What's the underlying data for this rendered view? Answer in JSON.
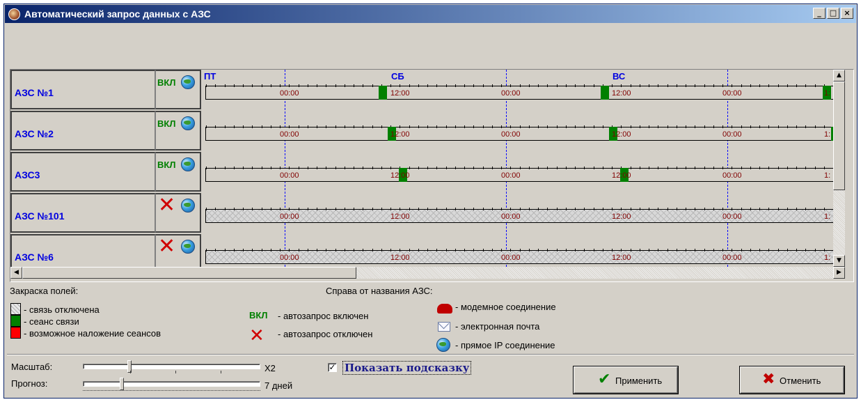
{
  "window": {
    "title": "Автоматический запрос данных с АЗС",
    "buttons": [
      "_",
      "□",
      "×"
    ]
  },
  "timeline": {
    "days": [
      "ПТ",
      "СБ",
      "ВС"
    ],
    "time_labels": [
      "00:00",
      "12:00",
      "00:00",
      "12:00",
      "00:00",
      "1:"
    ]
  },
  "stations": [
    {
      "name": "АЗС №1",
      "status": "ВКЛ",
      "enabled": true,
      "connection": "globe-icon"
    },
    {
      "name": "АЗС №2",
      "status": "ВКЛ",
      "enabled": true,
      "connection": "globe-icon"
    },
    {
      "name": "АЗС3",
      "status": "ВКЛ",
      "enabled": true,
      "connection": "globe-icon"
    },
    {
      "name": "АЗС №101",
      "status": "",
      "enabled": false,
      "connection": "globe-icon"
    },
    {
      "name": "АЗС №6",
      "status": "",
      "enabled": false,
      "connection": "globe-icon"
    }
  ],
  "legend": {
    "fill_title": "Закраска полей:",
    "fill_items": [
      {
        "label": "- связь отключена",
        "color": "#d8d8d8"
      },
      {
        "label": "- сеанс связи",
        "color": "#008000"
      },
      {
        "label": "- возможное наложение сеансов",
        "color": "#ff0000"
      }
    ],
    "right_title": "Справа от названия АЗС:",
    "vkl_symbol": "ВКЛ",
    "vkl_label": "- автозапрос включен",
    "off_label": "- автозапрос отключен",
    "modem_label": "- модемное соединение",
    "email_label": "- электронная почта",
    "ip_label": "- прямое IP соединение"
  },
  "controls": {
    "scale_label": "Масштаб:",
    "scale_value": "X2",
    "forecast_label": "Прогноз:",
    "forecast_value": "7 дней",
    "show_hint_label": "Показать подсказку",
    "show_hint_checked": true,
    "apply_label": "Применить",
    "cancel_label": "Отменить"
  },
  "colors": {
    "title_bar": "#0a246a",
    "station_name": "#0000e0",
    "session": "#008000",
    "time_label": "#800000"
  }
}
